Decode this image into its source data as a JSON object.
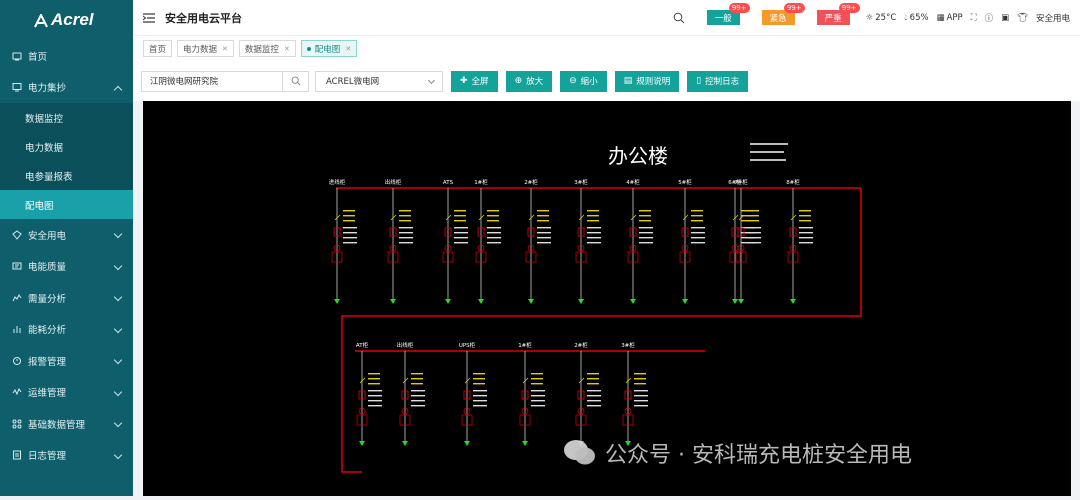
{
  "brand": "Acrel",
  "app_title": "安全用电云平台",
  "colors": {
    "sidebar": "#0e5e6b",
    "accent": "#14a39a",
    "active_sub": "#1aa0a8",
    "bus": "#e0000f",
    "badge_general": "#14a39a",
    "badge_urgent": "#f39a2b",
    "badge_severe": "#f0525a"
  },
  "sidebar": {
    "items": [
      {
        "label": "首页",
        "icon": "home-icon"
      },
      {
        "label": "电力集抄",
        "icon": "monitor-icon",
        "expanded": true,
        "children": [
          {
            "label": "数据监控"
          },
          {
            "label": "电力数据"
          },
          {
            "label": "电参量报表"
          },
          {
            "label": "配电图",
            "active": true
          }
        ]
      },
      {
        "label": "安全用电",
        "icon": "shield-icon"
      },
      {
        "label": "电能质量",
        "icon": "quality-icon"
      },
      {
        "label": "需量分析",
        "icon": "demand-icon"
      },
      {
        "label": "能耗分析",
        "icon": "bar-chart-icon"
      },
      {
        "label": "报警管理",
        "icon": "alarm-icon"
      },
      {
        "label": "运维管理",
        "icon": "maintenance-icon"
      },
      {
        "label": "基础数据管理",
        "icon": "data-icon"
      },
      {
        "label": "日志管理",
        "icon": "log-icon"
      }
    ]
  },
  "header": {
    "alarms": [
      {
        "label": "一般",
        "count": "99+"
      },
      {
        "label": "紧急",
        "count": "99+"
      },
      {
        "label": "严重",
        "count": "99+"
      }
    ],
    "weather": "25°C",
    "humidity": "65%",
    "app_label": "APP",
    "user_label": "安全用电"
  },
  "tabs": [
    {
      "label": "首页",
      "closable": false
    },
    {
      "label": "电力数据",
      "closable": true
    },
    {
      "label": "数据监控",
      "closable": true
    },
    {
      "label": "配电图",
      "closable": true,
      "active": true
    }
  ],
  "toolbar": {
    "search_value": "江阴微电网研究院",
    "select_value": "ACREL微电网",
    "buttons": [
      {
        "label": "全屏",
        "icon": "plus-icon"
      },
      {
        "label": "放大",
        "icon": "zoom-in-icon"
      },
      {
        "label": "缩小",
        "icon": "zoom-out-icon"
      },
      {
        "label": "规则说明",
        "icon": "doc-icon"
      },
      {
        "label": "控制日志",
        "icon": "log-icon"
      }
    ]
  },
  "diagram": {
    "title": "办公楼",
    "upper_feeders": [
      "进线柜",
      "出线柜",
      "ATS",
      "1#柜",
      "2#柜",
      "3#柜",
      "4#柜",
      "5#柜",
      "6#柜",
      "7#柜",
      "8#柜"
    ],
    "lower_feeders": [
      "AT柜",
      "出线柜",
      "UPS柜",
      "1#柜",
      "2#柜",
      "3#柜"
    ]
  },
  "watermark": "公众号 · 安科瑞充电桩安全用电"
}
